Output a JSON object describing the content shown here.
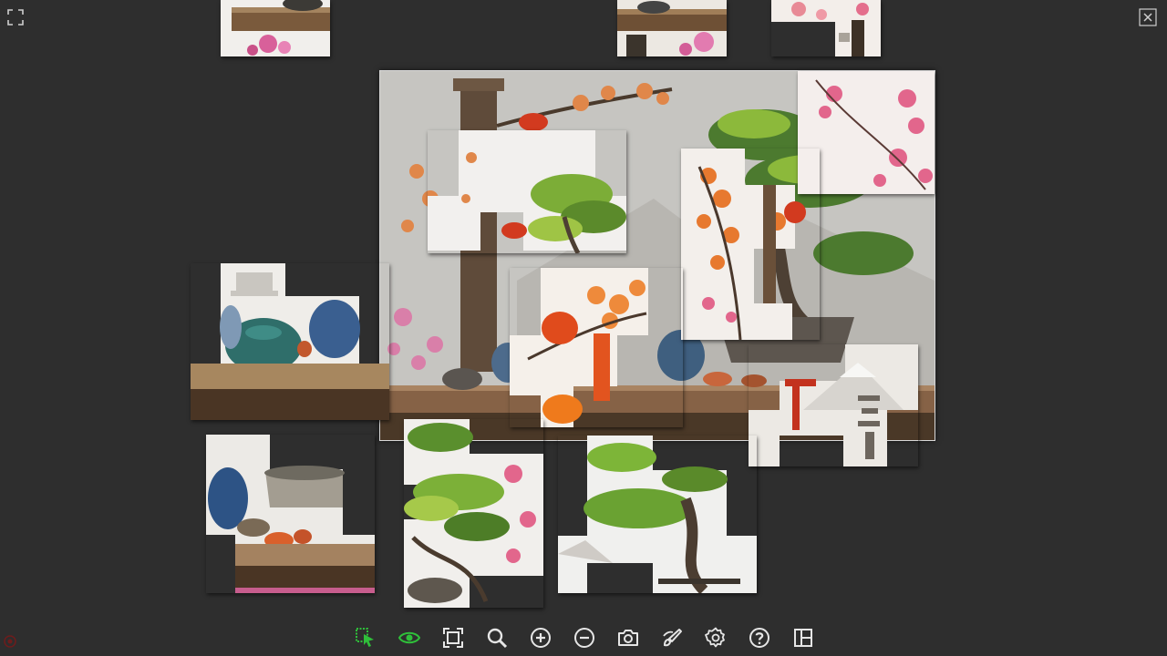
{
  "app": {
    "type": "jigsaw-puzzle"
  },
  "colors": {
    "background": "#2e2e2e",
    "toolbar_icon": "#e6e6e6",
    "active_icon": "#2fbf3a",
    "status_dot": "#6e1c1c"
  },
  "controls": {
    "fullscreen_icon": "expand-corners-icon",
    "close_icon": "close-x-icon"
  },
  "toolbar": {
    "tools": [
      {
        "icon": "select-pieces-icon",
        "active": true
      },
      {
        "icon": "eye-preview-icon",
        "active": true
      },
      {
        "icon": "fit-frame-icon",
        "active": false
      },
      {
        "icon": "magnifier-icon",
        "active": false
      },
      {
        "icon": "zoom-in-icon",
        "active": false
      },
      {
        "icon": "zoom-out-icon",
        "active": false
      },
      {
        "icon": "camera-icon",
        "active": false
      },
      {
        "icon": "paint-brush-icon",
        "active": false
      },
      {
        "icon": "gear-icon",
        "active": false
      },
      {
        "icon": "help-icon",
        "active": false
      },
      {
        "icon": "layout-panel-icon",
        "active": false
      }
    ]
  },
  "puzzle": {
    "scene": "bonsai-shelf-with-lanterns-and-blossoms"
  }
}
